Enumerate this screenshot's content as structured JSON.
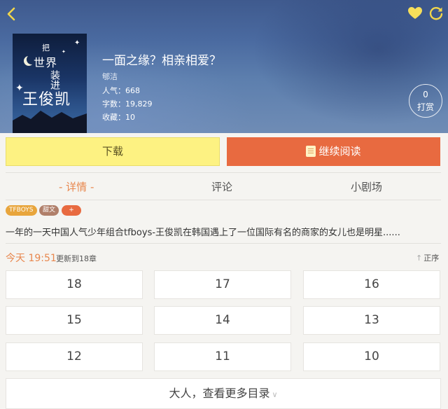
{
  "book": {
    "title": "一面之缘？相亲相爱？",
    "author": "郇洁",
    "popularity": "人气：668",
    "words": "字数：19,829",
    "favorites": "收藏：10",
    "cover_text": [
      "把",
      "世界",
      "装进",
      "王俊凯"
    ]
  },
  "tip": {
    "count": "0",
    "label": "打赏"
  },
  "actions": {
    "download": "下载",
    "continue_read": "继续阅读"
  },
  "tabs": [
    "- 详情 -",
    "评论",
    "小剧场"
  ],
  "tags": [
    "TFBOYS",
    "甜文",
    "+"
  ],
  "description": "一年的一天中国人气少年组合tfboys-王俊凯在韩国遇上了一位国际有名的商家的女儿也是明星......",
  "update": {
    "time": "今天 19:51",
    "text": "更新到18章",
    "sort_label": "正序"
  },
  "chapters": [
    "18",
    "17",
    "16",
    "15",
    "14",
    "13",
    "12",
    "11",
    "10"
  ],
  "more_button": "大人，查看更多目录",
  "colors": {
    "accent_orange": "#e86a40",
    "download_yellow": "#fdf282",
    "active_tab": "#e8874e"
  },
  "icons": [
    "back-arrow-icon",
    "heart-icon",
    "refresh-icon",
    "book-icon",
    "sort-arrow-icon",
    "chevron-down-icon"
  ]
}
